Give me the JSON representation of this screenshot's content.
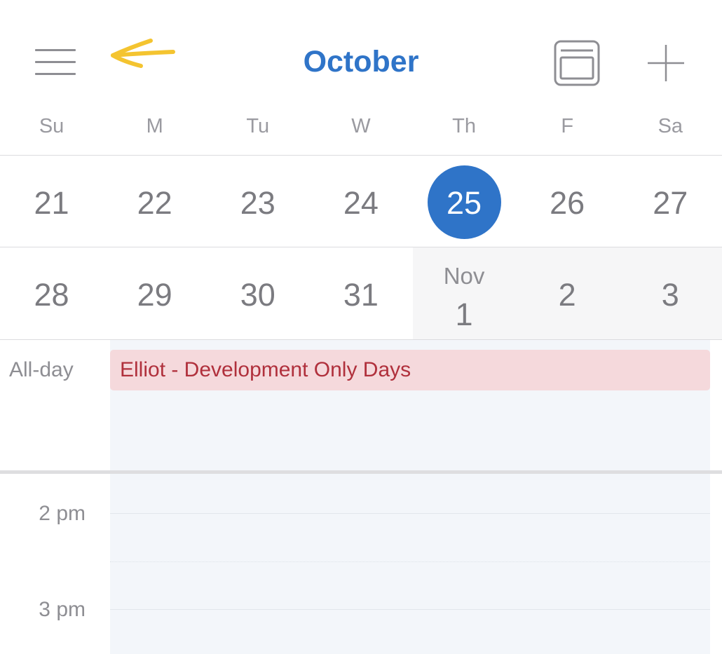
{
  "header": {
    "title": "October",
    "menu_icon": "hamburger-menu-icon",
    "annotation_icon": "yellow-hand-drawn-arrow",
    "view_icon": "calendar-view-icon",
    "add_icon": "plus-icon"
  },
  "colors": {
    "accent": "#2f74c8",
    "event_bg": "#f5d9dc",
    "event_text": "#b0303c",
    "annotation": "#f4c430"
  },
  "weekdays": [
    "Su",
    "M",
    "Tu",
    "W",
    "Th",
    "F",
    "Sa"
  ],
  "weeks": [
    {
      "days": [
        {
          "label": "21"
        },
        {
          "label": "22"
        },
        {
          "label": "23"
        },
        {
          "label": "24"
        },
        {
          "label": "25",
          "today": true
        },
        {
          "label": "26"
        },
        {
          "label": "27"
        }
      ]
    },
    {
      "days": [
        {
          "label": "28"
        },
        {
          "label": "29"
        },
        {
          "label": "30"
        },
        {
          "label": "31"
        },
        {
          "month": "Nov",
          "label": "1"
        },
        {
          "label": "2"
        },
        {
          "label": "3"
        }
      ]
    }
  ],
  "allday": {
    "label": "All-day",
    "events": [
      {
        "title": "Elliot - Development Only Days"
      }
    ]
  },
  "timeline": {
    "hours": [
      "2 pm",
      "3 pm"
    ]
  }
}
